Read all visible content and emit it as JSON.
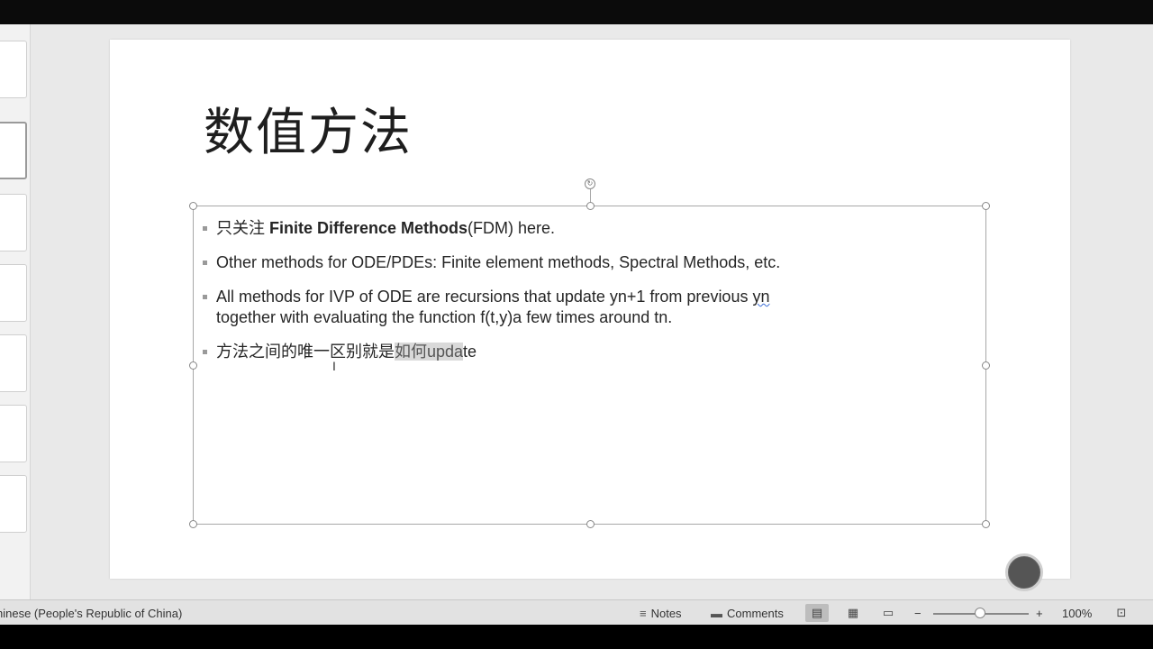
{
  "slide": {
    "title": "数值方法",
    "bullets": [
      {
        "prefix": "只关注 ",
        "bold": "Finite Difference Methods",
        "suffix": "(FDM) here."
      },
      {
        "text": "Other methods for ODE/PDEs: Finite element methods, Spectral Methods, etc."
      },
      {
        "line1_main": "All methods for IVP of ODE are recursions that update yn+1 from previous ",
        "line1_squiggle": "yn",
        "line2": "together with evaluating the function f(t,y)a few times around tn."
      },
      {
        "before": "方法之间的唯一区别就是",
        "highlight": "如何upda",
        "after": "te"
      }
    ]
  },
  "status": {
    "language": "hinese (People's Republic of China)",
    "notes": "Notes",
    "comments": "Comments",
    "zoom_minus": "−",
    "zoom_plus": "+",
    "zoom": "100%"
  },
  "icons": {
    "notes": "notes-icon",
    "comments": "comment-icon",
    "rotate": "rotate-handle-icon",
    "text_cursor": "i-beam-cursor-icon",
    "record": "record-button-icon"
  }
}
